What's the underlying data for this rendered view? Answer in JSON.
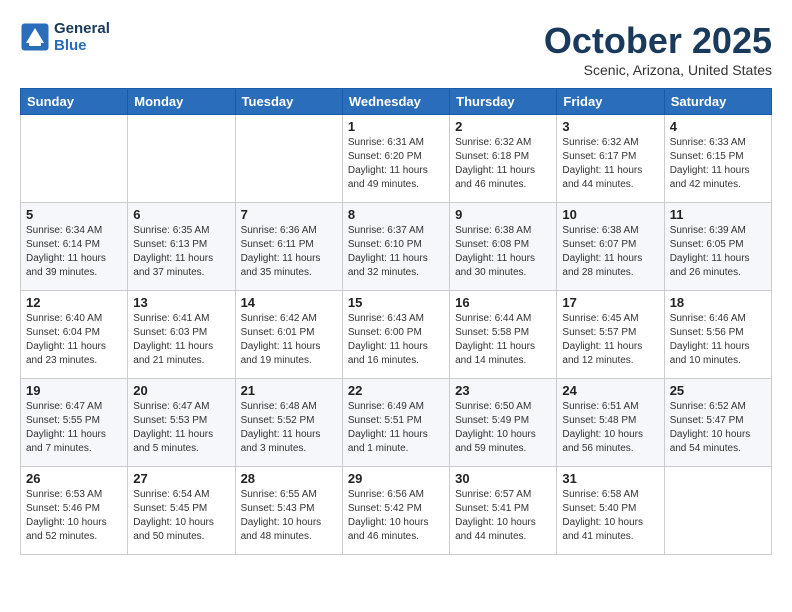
{
  "header": {
    "logo_line1": "General",
    "logo_line2": "Blue",
    "month": "October 2025",
    "location": "Scenic, Arizona, United States"
  },
  "weekdays": [
    "Sunday",
    "Monday",
    "Tuesday",
    "Wednesday",
    "Thursday",
    "Friday",
    "Saturday"
  ],
  "weeks": [
    [
      {
        "day": "",
        "info": ""
      },
      {
        "day": "",
        "info": ""
      },
      {
        "day": "",
        "info": ""
      },
      {
        "day": "1",
        "info": "Sunrise: 6:31 AM\nSunset: 6:20 PM\nDaylight: 11 hours\nand 49 minutes."
      },
      {
        "day": "2",
        "info": "Sunrise: 6:32 AM\nSunset: 6:18 PM\nDaylight: 11 hours\nand 46 minutes."
      },
      {
        "day": "3",
        "info": "Sunrise: 6:32 AM\nSunset: 6:17 PM\nDaylight: 11 hours\nand 44 minutes."
      },
      {
        "day": "4",
        "info": "Sunrise: 6:33 AM\nSunset: 6:15 PM\nDaylight: 11 hours\nand 42 minutes."
      }
    ],
    [
      {
        "day": "5",
        "info": "Sunrise: 6:34 AM\nSunset: 6:14 PM\nDaylight: 11 hours\nand 39 minutes."
      },
      {
        "day": "6",
        "info": "Sunrise: 6:35 AM\nSunset: 6:13 PM\nDaylight: 11 hours\nand 37 minutes."
      },
      {
        "day": "7",
        "info": "Sunrise: 6:36 AM\nSunset: 6:11 PM\nDaylight: 11 hours\nand 35 minutes."
      },
      {
        "day": "8",
        "info": "Sunrise: 6:37 AM\nSunset: 6:10 PM\nDaylight: 11 hours\nand 32 minutes."
      },
      {
        "day": "9",
        "info": "Sunrise: 6:38 AM\nSunset: 6:08 PM\nDaylight: 11 hours\nand 30 minutes."
      },
      {
        "day": "10",
        "info": "Sunrise: 6:38 AM\nSunset: 6:07 PM\nDaylight: 11 hours\nand 28 minutes."
      },
      {
        "day": "11",
        "info": "Sunrise: 6:39 AM\nSunset: 6:05 PM\nDaylight: 11 hours\nand 26 minutes."
      }
    ],
    [
      {
        "day": "12",
        "info": "Sunrise: 6:40 AM\nSunset: 6:04 PM\nDaylight: 11 hours\nand 23 minutes."
      },
      {
        "day": "13",
        "info": "Sunrise: 6:41 AM\nSunset: 6:03 PM\nDaylight: 11 hours\nand 21 minutes."
      },
      {
        "day": "14",
        "info": "Sunrise: 6:42 AM\nSunset: 6:01 PM\nDaylight: 11 hours\nand 19 minutes."
      },
      {
        "day": "15",
        "info": "Sunrise: 6:43 AM\nSunset: 6:00 PM\nDaylight: 11 hours\nand 16 minutes."
      },
      {
        "day": "16",
        "info": "Sunrise: 6:44 AM\nSunset: 5:58 PM\nDaylight: 11 hours\nand 14 minutes."
      },
      {
        "day": "17",
        "info": "Sunrise: 6:45 AM\nSunset: 5:57 PM\nDaylight: 11 hours\nand 12 minutes."
      },
      {
        "day": "18",
        "info": "Sunrise: 6:46 AM\nSunset: 5:56 PM\nDaylight: 11 hours\nand 10 minutes."
      }
    ],
    [
      {
        "day": "19",
        "info": "Sunrise: 6:47 AM\nSunset: 5:55 PM\nDaylight: 11 hours\nand 7 minutes."
      },
      {
        "day": "20",
        "info": "Sunrise: 6:47 AM\nSunset: 5:53 PM\nDaylight: 11 hours\nand 5 minutes."
      },
      {
        "day": "21",
        "info": "Sunrise: 6:48 AM\nSunset: 5:52 PM\nDaylight: 11 hours\nand 3 minutes."
      },
      {
        "day": "22",
        "info": "Sunrise: 6:49 AM\nSunset: 5:51 PM\nDaylight: 11 hours\nand 1 minute."
      },
      {
        "day": "23",
        "info": "Sunrise: 6:50 AM\nSunset: 5:49 PM\nDaylight: 10 hours\nand 59 minutes."
      },
      {
        "day": "24",
        "info": "Sunrise: 6:51 AM\nSunset: 5:48 PM\nDaylight: 10 hours\nand 56 minutes."
      },
      {
        "day": "25",
        "info": "Sunrise: 6:52 AM\nSunset: 5:47 PM\nDaylight: 10 hours\nand 54 minutes."
      }
    ],
    [
      {
        "day": "26",
        "info": "Sunrise: 6:53 AM\nSunset: 5:46 PM\nDaylight: 10 hours\nand 52 minutes."
      },
      {
        "day": "27",
        "info": "Sunrise: 6:54 AM\nSunset: 5:45 PM\nDaylight: 10 hours\nand 50 minutes."
      },
      {
        "day": "28",
        "info": "Sunrise: 6:55 AM\nSunset: 5:43 PM\nDaylight: 10 hours\nand 48 minutes."
      },
      {
        "day": "29",
        "info": "Sunrise: 6:56 AM\nSunset: 5:42 PM\nDaylight: 10 hours\nand 46 minutes."
      },
      {
        "day": "30",
        "info": "Sunrise: 6:57 AM\nSunset: 5:41 PM\nDaylight: 10 hours\nand 44 minutes."
      },
      {
        "day": "31",
        "info": "Sunrise: 6:58 AM\nSunset: 5:40 PM\nDaylight: 10 hours\nand 41 minutes."
      },
      {
        "day": "",
        "info": ""
      }
    ]
  ]
}
